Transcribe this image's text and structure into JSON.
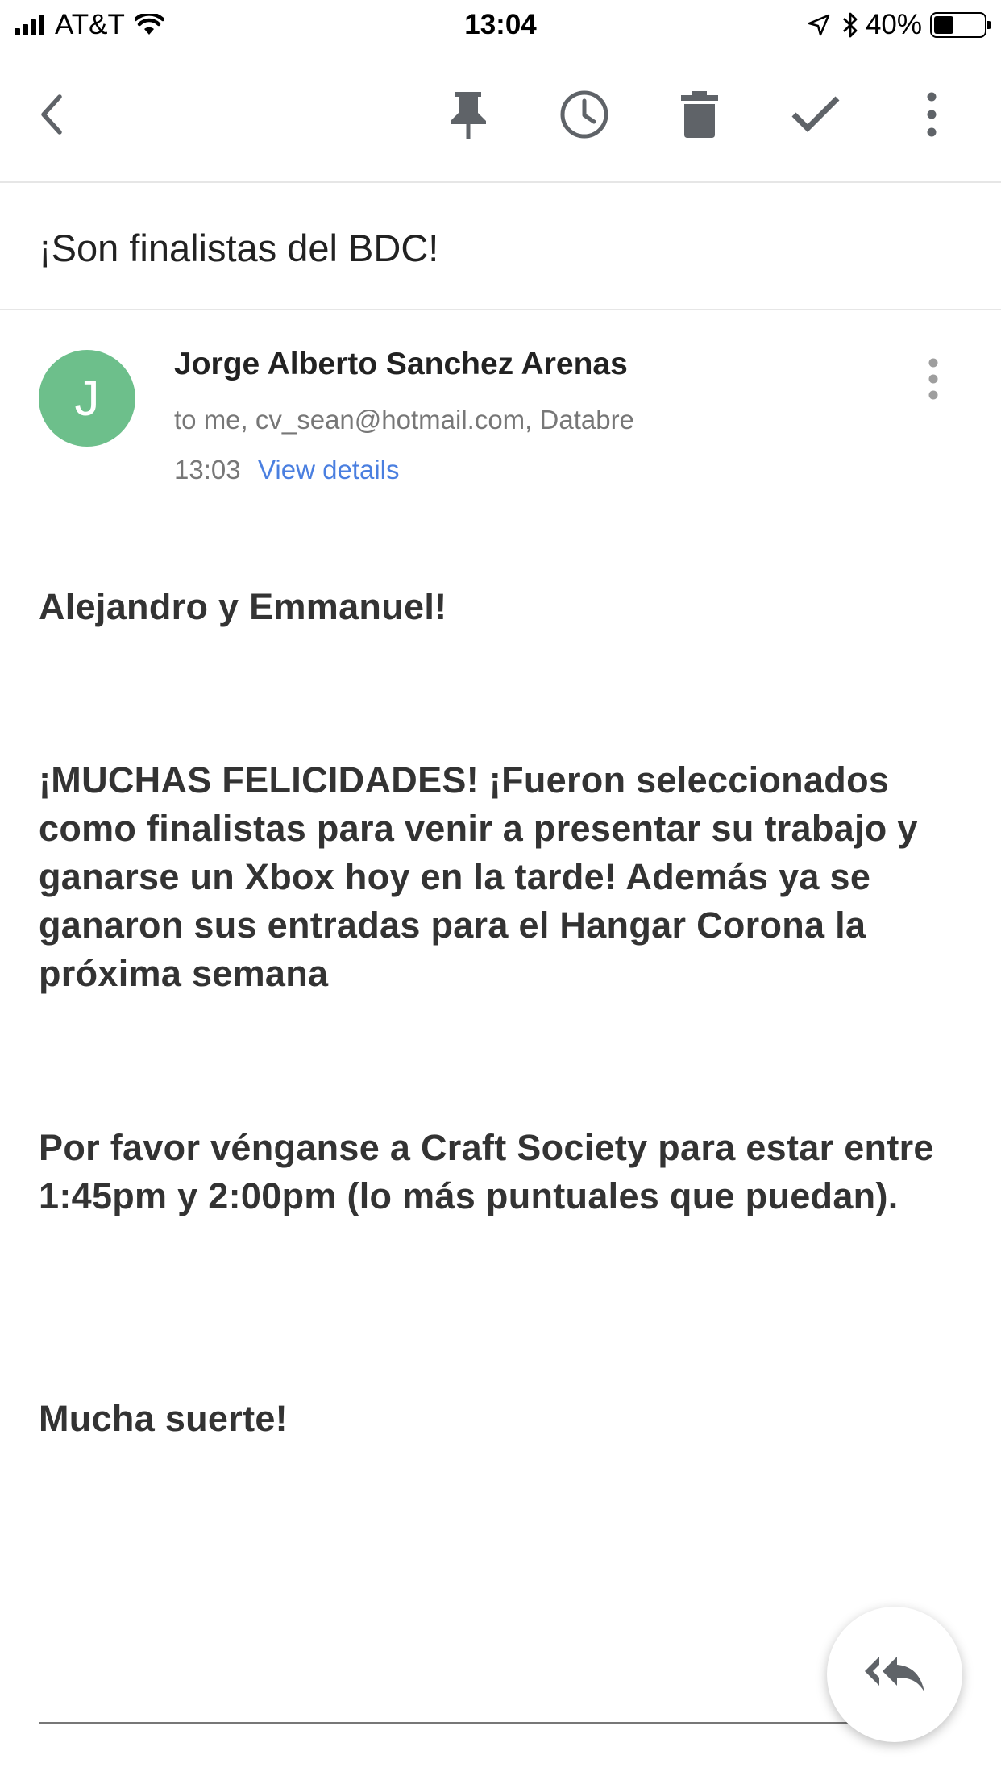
{
  "status_bar": {
    "carrier": "AT&T",
    "time": "13:04",
    "battery_percent": "40%",
    "battery_level": 0.4,
    "icons": [
      "signal-icon",
      "wifi-icon",
      "location-icon",
      "bluetooth-icon",
      "battery-icon"
    ]
  },
  "toolbar": {
    "icons": [
      "back-arrow-icon",
      "pin-icon",
      "clock-icon",
      "trash-icon",
      "check-icon",
      "more-vert-icon"
    ]
  },
  "email": {
    "subject": "¡Son finalistas del BDC!",
    "sender": {
      "initial": "J",
      "avatar_color": "#6dbf8b",
      "name": "Jorge Alberto Sanchez Arenas",
      "recipients": "to me, cv_sean@hotmail.com, Databre",
      "time": "13:03",
      "view_details": "View details"
    },
    "body": {
      "greeting": "Alejandro y Emmanuel!",
      "paragraph1": "¡MUCHAS FELICIDADES! ¡Fueron seleccionados como finalistas para venir a presentar su trabajo y ganarse un Xbox hoy en la tarde! Además ya se ganaron sus entradas para el Hangar Corona la próxima semana",
      "paragraph2": "Por favor vénganse a Craft Society para estar entre 1:45pm y 2:00pm (lo más puntuales que puedan).",
      "closing": "Mucha suerte!"
    }
  },
  "colors": {
    "icon_gray": "#5f6368",
    "link_blue": "#4a7fe0"
  }
}
